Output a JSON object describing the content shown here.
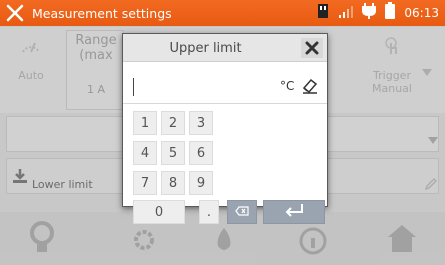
{
  "status_bar": {
    "title": "Measurement settings",
    "time": "06:13",
    "accent_color": "#f26a21",
    "icons": [
      "settings-icon",
      "sd-card-icon",
      "signal-icon",
      "power-plug-icon",
      "battery-icon"
    ]
  },
  "background": {
    "cells": [
      {
        "label": "Auto"
      },
      {
        "label_line1": "Range",
        "label_line2": "(max",
        "value": "1 A"
      },
      {
        "label_line1": "Trigger",
        "label_line2": "Manual"
      }
    ],
    "lower_limit_label": "Lower limit",
    "bottom_icons": [
      "probe-icon",
      "gear-icon",
      "flame-icon",
      "info-icon",
      "home-icon"
    ]
  },
  "dialog": {
    "title": "Upper limit",
    "input_value": "",
    "unit": "°C",
    "keys": [
      "1",
      "2",
      "3",
      "4",
      "5",
      "6",
      "7",
      "8",
      "9",
      "0",
      "."
    ]
  }
}
